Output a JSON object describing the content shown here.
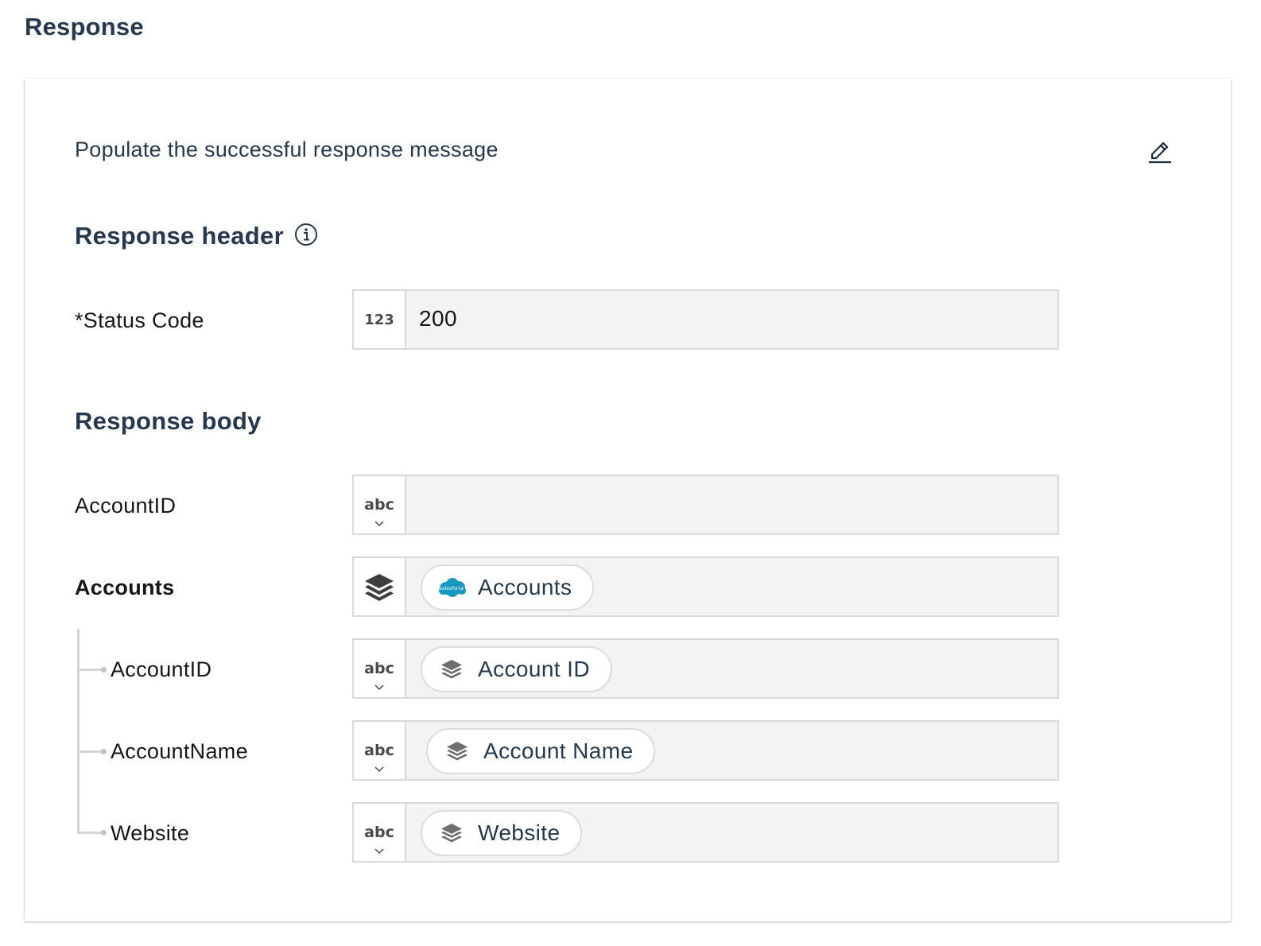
{
  "page": {
    "title": "Response"
  },
  "card": {
    "description": "Populate the successful response message",
    "edit_icon": "pencil-icon"
  },
  "response_header": {
    "heading": "Response header",
    "info_icon": "info-icon",
    "status_code": {
      "label": "*Status Code",
      "type_badge": "123",
      "value": "200"
    }
  },
  "response_body": {
    "heading": "Response body",
    "account_id": {
      "label": "AccountID",
      "type_badge": "abc",
      "value": ""
    },
    "accounts": {
      "label": "Accounts",
      "type_icon": "layers-icon",
      "pill": {
        "label": "Accounts",
        "icon": "salesforce-icon",
        "icon_text": "salesforce"
      }
    },
    "children": [
      {
        "label": "AccountID",
        "type_badge": "abc",
        "pill_label": "Account ID",
        "pill_icon": "layers-icon"
      },
      {
        "label": "AccountName",
        "type_badge": "abc",
        "pill_label": "Account Name",
        "pill_icon": "layers-icon"
      },
      {
        "label": "Website",
        "type_badge": "abc",
        "pill_label": "Website",
        "pill_icon": "layers-icon"
      }
    ]
  },
  "colors": {
    "heading": "#24394f",
    "field_bg": "#f3f3f3",
    "field_border": "#d9d9d9",
    "salesforce_blue": "#1798c1"
  }
}
